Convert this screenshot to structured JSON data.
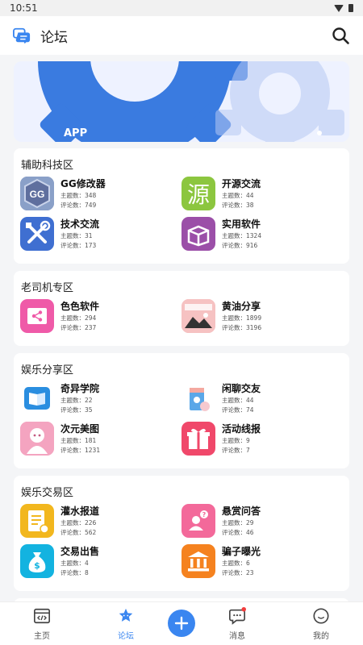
{
  "status": {
    "time": "10:51"
  },
  "topbar": {
    "title": "论坛"
  },
  "banner": {
    "text": "APP"
  },
  "sections": [
    {
      "title": "辅助科技区",
      "items": [
        {
          "name": "GG修改器",
          "topics": "主题数：348",
          "comments": "评论数：749",
          "icon": "gg-icon",
          "color": "#7a8fb8"
        },
        {
          "name": "开源交流",
          "topics": "主题数：44",
          "comments": "评论数：38",
          "icon": "source-icon",
          "color": "#8cc63f"
        },
        {
          "name": "技术交流",
          "topics": "主题数：31",
          "comments": "评论数：173",
          "icon": "tools-icon",
          "color": "#3f6fd1"
        },
        {
          "name": "实用软件",
          "topics": "主题数：1324",
          "comments": "评论数：916",
          "icon": "box-icon",
          "color": "#9b4fa8"
        }
      ]
    },
    {
      "title": "老司机专区",
      "items": [
        {
          "name": "色色软件",
          "topics": "主题数：294",
          "comments": "评论数：237",
          "icon": "share-folder-icon",
          "color": "#ef5aa8"
        },
        {
          "name": "黄油分享",
          "topics": "主题数：1899",
          "comments": "评论数：3196",
          "icon": "game-picture-icon",
          "color": "#f4b6b6"
        }
      ]
    },
    {
      "title": "娱乐分享区",
      "items": [
        {
          "name": "奇异学院",
          "topics": "主题数：22",
          "comments": "评论数：35",
          "icon": "book-icon",
          "color": "#2a8ee0"
        },
        {
          "name": "闲聊交友",
          "topics": "主题数：44",
          "comments": "评论数：74",
          "icon": "drink-icon",
          "color": "#ffffff"
        },
        {
          "name": "次元美图",
          "topics": "主题数：181",
          "comments": "评论数：1231",
          "icon": "anime-girl-icon",
          "color": "#f19bb8"
        },
        {
          "name": "活动线报",
          "topics": "主题数：9",
          "comments": "评论数：7",
          "icon": "gift-icon",
          "color": "#f0486a"
        }
      ]
    },
    {
      "title": "娱乐交易区",
      "items": [
        {
          "name": "灌水报道",
          "topics": "主题数：226",
          "comments": "评论数：562",
          "icon": "document-icon",
          "color": "#f2b71e"
        },
        {
          "name": "悬赏问答",
          "topics": "主题数：29",
          "comments": "评论数：46",
          "icon": "question-user-icon",
          "color": "#f3699a"
        },
        {
          "name": "交易出售",
          "topics": "主题数：4",
          "comments": "评论数：8",
          "icon": "money-bag-icon",
          "color": "#13b3e0"
        },
        {
          "name": "骗子曝光",
          "topics": "主题数：6",
          "comments": "评论数：23",
          "icon": "bank-icon",
          "color": "#f5821f"
        }
      ]
    }
  ],
  "nav": {
    "home": "主页",
    "forum": "论坛",
    "messages": "消息",
    "mine": "我的"
  },
  "colors": {
    "accent": "#3a86f0",
    "badge": "#f23c3c"
  }
}
